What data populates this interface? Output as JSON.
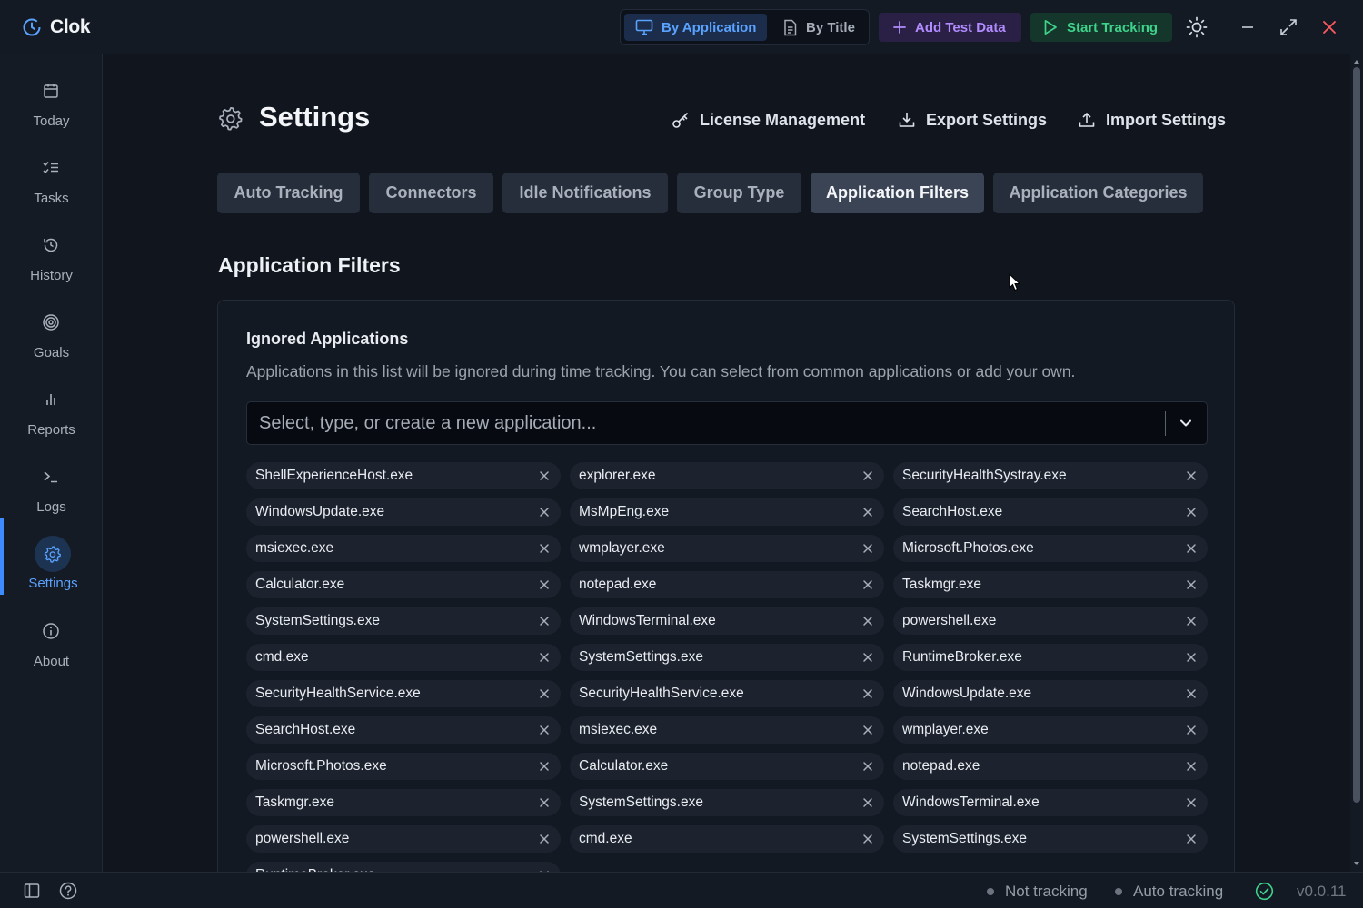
{
  "app": {
    "name": "Clok"
  },
  "titlebar": {
    "view_by_application": "By Application",
    "view_by_title": "By Title",
    "add_test_data": "Add Test Data",
    "start_tracking": "Start Tracking"
  },
  "sidebar": {
    "items": [
      {
        "label": "Today",
        "icon": "calendar-icon"
      },
      {
        "label": "Tasks",
        "icon": "list-checks-icon"
      },
      {
        "label": "History",
        "icon": "history-icon"
      },
      {
        "label": "Goals",
        "icon": "target-icon"
      },
      {
        "label": "Reports",
        "icon": "bar-chart-icon"
      },
      {
        "label": "Logs",
        "icon": "terminal-icon"
      },
      {
        "label": "Settings",
        "icon": "gear-icon",
        "active": true
      },
      {
        "label": "About",
        "icon": "info-icon"
      }
    ]
  },
  "page": {
    "title": "Settings",
    "actions": {
      "license": "License Management",
      "export": "Export Settings",
      "import": "Import Settings"
    },
    "tabs": [
      {
        "label": "Auto Tracking"
      },
      {
        "label": "Connectors"
      },
      {
        "label": "Idle Notifications"
      },
      {
        "label": "Group Type"
      },
      {
        "label": "Application Filters",
        "active": true
      },
      {
        "label": "Application Categories"
      }
    ],
    "section_title": "Application Filters",
    "card": {
      "title": "Ignored Applications",
      "description": "Applications in this list will be ignored during time tracking. You can select from common applications or add your own.",
      "select_placeholder": "Select, type, or create a new application...",
      "ignored_apps": [
        "ShellExperienceHost.exe",
        "explorer.exe",
        "SecurityHealthSystray.exe",
        "WindowsUpdate.exe",
        "MsMpEng.exe",
        "SearchHost.exe",
        "msiexec.exe",
        "wmplayer.exe",
        "Microsoft.Photos.exe",
        "Calculator.exe",
        "notepad.exe",
        "Taskmgr.exe",
        "SystemSettings.exe",
        "WindowsTerminal.exe",
        "powershell.exe",
        "cmd.exe",
        "SystemSettings.exe",
        "RuntimeBroker.exe",
        "SecurityHealthService.exe",
        "SecurityHealthService.exe",
        "WindowsUpdate.exe",
        "SearchHost.exe",
        "msiexec.exe",
        "wmplayer.exe",
        "Microsoft.Photos.exe",
        "Calculator.exe",
        "notepad.exe",
        "Taskmgr.exe",
        "SystemSettings.exe",
        "WindowsTerminal.exe",
        "powershell.exe",
        "cmd.exe",
        "SystemSettings.exe",
        "RuntimeBroker.exe"
      ]
    }
  },
  "statusbar": {
    "tracking": "Not tracking",
    "auto_tracking": "Auto tracking",
    "version": "v0.0.11"
  },
  "colors": {
    "accent_blue": "#3d8bfd",
    "add_test_purple": "#b28cff",
    "start_green": "#3fd28b",
    "close_red": "#ff5a5f"
  }
}
